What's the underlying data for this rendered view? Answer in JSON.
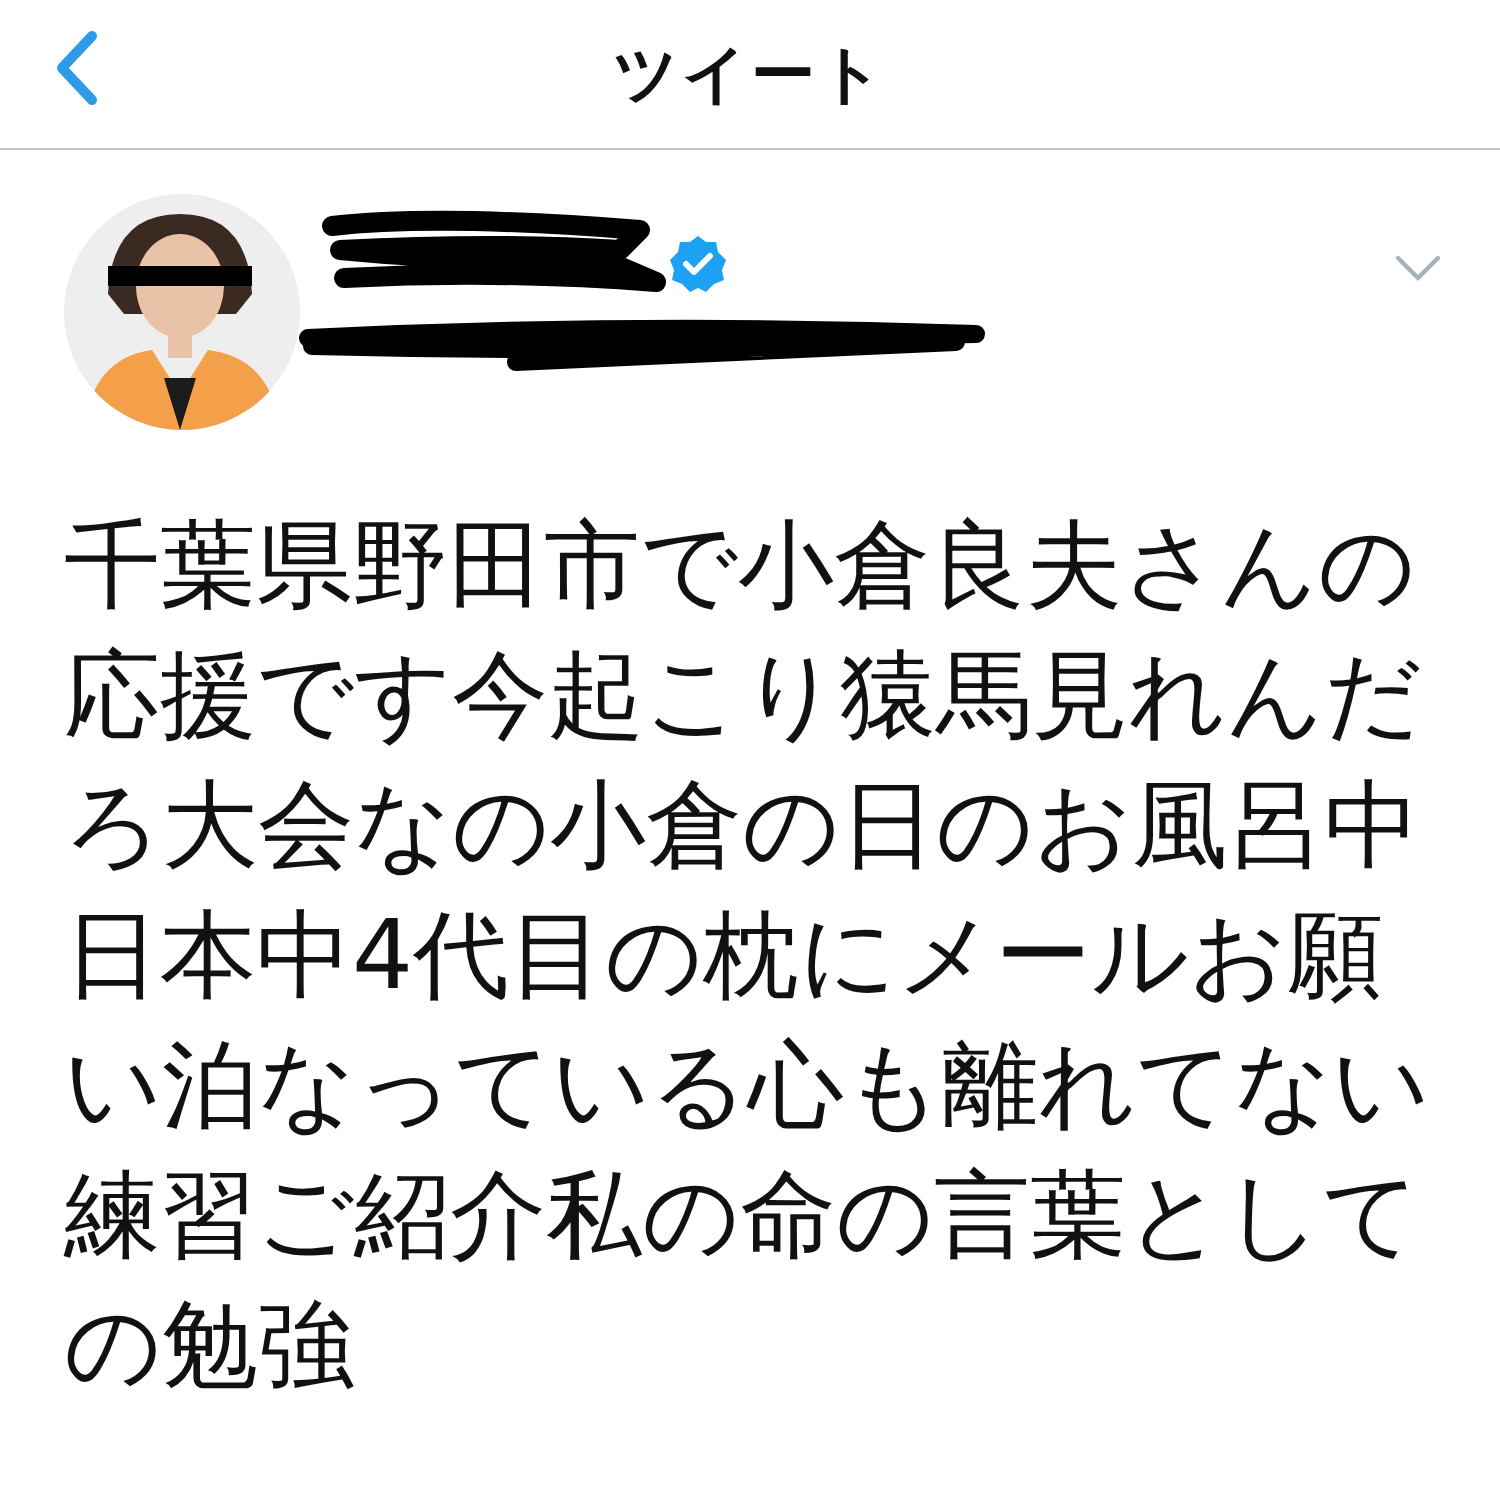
{
  "header": {
    "title": "ツイート"
  },
  "tweet": {
    "author": {
      "verified": true
    },
    "text": "千葉県野田市で小倉良夫さんの応援です今起こり猿馬見れんだろ大会なの小倉の日のお風呂中日本中4代目の枕にメールお願い泊なっている心も離れてない練習ご紹介私の命の言葉としての勉強"
  }
}
